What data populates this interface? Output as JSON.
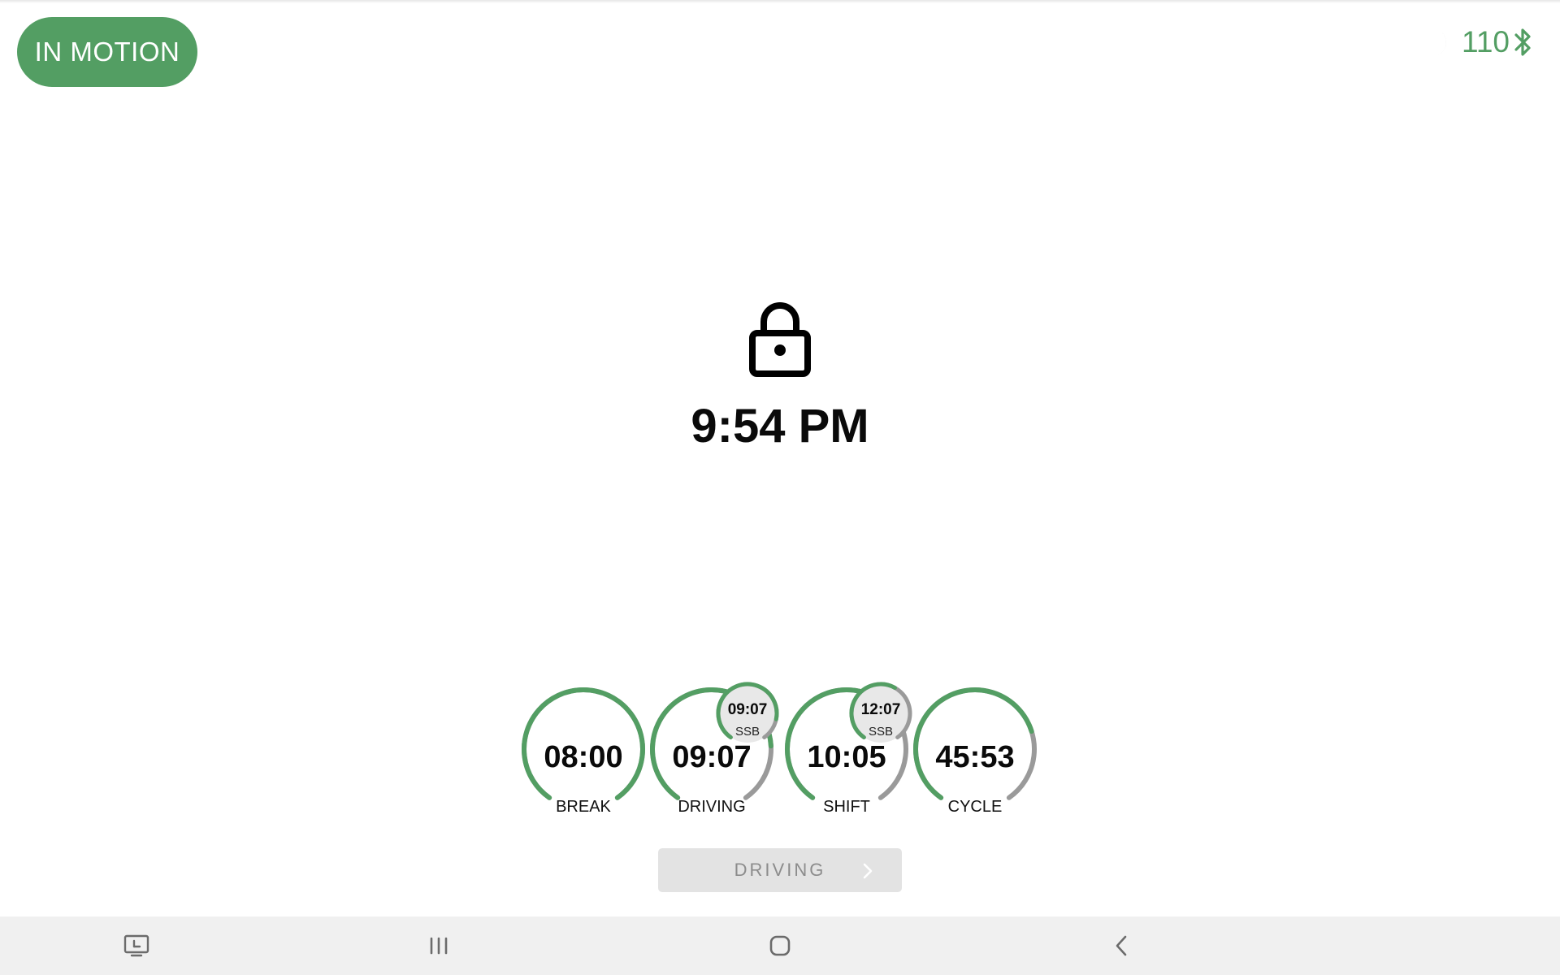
{
  "status_bar": {
    "motion_badge": "IN MOTION",
    "speed": "110",
    "icons": [
      "moon-icon",
      "bluetooth-icon"
    ]
  },
  "lock_screen": {
    "icon": "lock-icon",
    "time": "9:54 PM"
  },
  "gauges": [
    {
      "id": "break",
      "value": "08:00",
      "label": "BREAK",
      "progress": 1.0
    },
    {
      "id": "driving",
      "value": "09:07",
      "label": "DRIVING",
      "progress": 0.8,
      "sub": {
        "value": "09:07",
        "label": "SSB",
        "progress": 0.85
      }
    },
    {
      "id": "shift",
      "value": "10:05",
      "label": "SHIFT",
      "progress": 0.6,
      "sub": {
        "value": "12:07",
        "label": "SSB",
        "progress": 0.6
      }
    },
    {
      "id": "cycle",
      "value": "45:53",
      "label": "CYCLE",
      "progress": 0.75
    }
  ],
  "status_button": {
    "label": "DRIVING",
    "icon": "chevron-right-icon"
  },
  "nav_bar": {
    "items": [
      "screen-cast-icon",
      "recent-apps-icon",
      "home-icon",
      "back-icon"
    ]
  },
  "colors": {
    "accent": "#539e63",
    "track": "#9a9a9a",
    "button_bg": "#e3e3e3",
    "nav_bg": "#f0f0f0"
  }
}
